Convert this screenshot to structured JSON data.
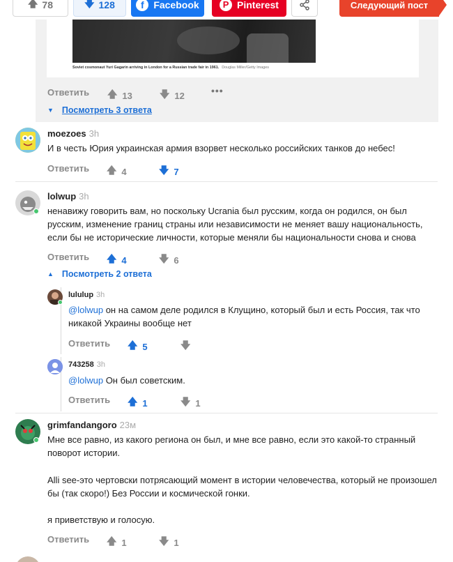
{
  "topbar": {
    "upvotes": "78",
    "downvotes": "128",
    "facebook": "Facebook",
    "pinterest": "Pinterest",
    "next_post": "Следующий пост"
  },
  "first_comment": {
    "photo_caption": "Soviet cosmonaut Yuri Gagarin arriving in London for a Russian trade fair in 1961.",
    "photo_credit": "Douglas Miller/Getty Images",
    "reply": "Ответить",
    "up": "13",
    "down": "12",
    "view_replies": "Посмотреть 3 ответа"
  },
  "comments": [
    {
      "user": "moezoes",
      "time": "3h",
      "text": "И в честь Юрия украинская армия взорвет несколько российских танков до небес!",
      "reply": "Ответить",
      "up": "4",
      "down": "7"
    },
    {
      "user": "lolwup",
      "time": "3h",
      "text": "ненавижу говорить вам, но поскольку Ucrania был русским, когда он родился, он был русским, изменение границ страны или независимости не меняет вашу национальность, если бы не исторические личности, которые меняли бы национальности снова и снова",
      "reply": "Ответить",
      "up": "4",
      "down": "6",
      "view_replies": "Посмотреть 2 ответа",
      "replies": [
        {
          "user": "lululup",
          "time": "3h",
          "mention": "@lolwup",
          "text": "он на самом деле родился в Клущино, который был и есть Россия, так что никакой Украины вообще нет",
          "reply": "Ответить",
          "up": "5",
          "down": ""
        },
        {
          "user": "743258",
          "time": "3h",
          "mention": "@lolwup",
          "text": "Он был советским.",
          "reply": "Ответить",
          "up": "1",
          "down": "1"
        }
      ]
    },
    {
      "user": "grimfandangoro",
      "time": "23м",
      "text1": "Мне все равно, из какого региона он был, и мне все равно, если это какой-то странный поворот истории.",
      "text2": "Alli see-это чертовски потрясающий момент в истории человечества, который не произошел бы (так скоро!) Без России и космической гонки.",
      "text3": "я приветствую и голосую.",
      "reply": "Ответить",
      "up": "1",
      "down": "1"
    }
  ],
  "colors": {
    "accent": "#1d6fd6",
    "facebook": "#1877f2",
    "pinterest": "#e60023",
    "next": "#e8432b",
    "online": "#47c66f"
  }
}
